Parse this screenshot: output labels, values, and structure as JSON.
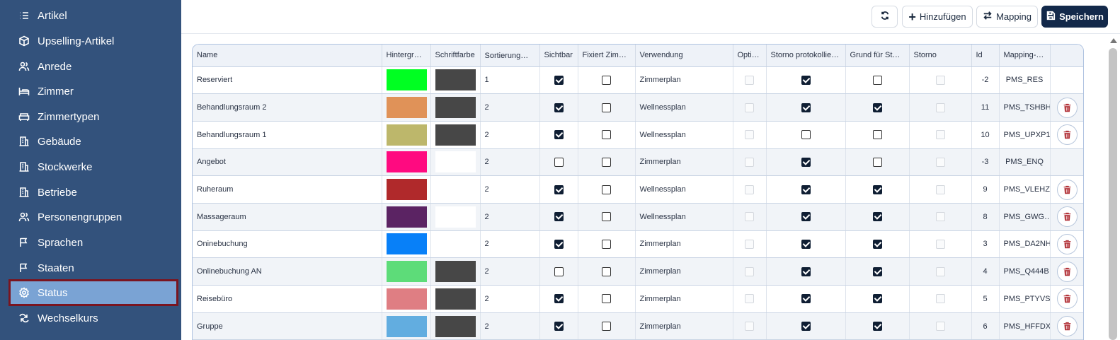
{
  "sidebar": {
    "items": [
      {
        "label": "Artikel",
        "icon": "list-icon"
      },
      {
        "label": "Upselling-Artikel",
        "icon": "package-icon"
      },
      {
        "label": "Anrede",
        "icon": "users-icon"
      },
      {
        "label": "Zimmer",
        "icon": "bed-icon"
      },
      {
        "label": "Zimmertypen",
        "icon": "sofa-icon"
      },
      {
        "label": "Gebäude",
        "icon": "building-icon"
      },
      {
        "label": "Stockwerke",
        "icon": "building-icon"
      },
      {
        "label": "Betriebe",
        "icon": "building-icon"
      },
      {
        "label": "Personengruppen",
        "icon": "users-icon"
      },
      {
        "label": "Sprachen",
        "icon": "flag-icon"
      },
      {
        "label": "Staaten",
        "icon": "flag-icon"
      },
      {
        "label": "Status",
        "icon": "gear-icon"
      },
      {
        "label": "Wechselkurs",
        "icon": "exchange-icon"
      }
    ],
    "active": "Status"
  },
  "toolbar": {
    "refresh_icon": "refresh-icon",
    "add_label": "Hinzufügen",
    "mapping_label": "Mapping",
    "save_label": "Speichern"
  },
  "table": {
    "columns": [
      "Name",
      "Hintergrun…",
      "Schriftfarbe",
      "Sortierung…",
      "Sichtbar",
      "Fixiert Zimmer",
      "Verwendung",
      "Opti…",
      "Storno protokollier…",
      "Grund für Stor…",
      "Storno",
      "Id",
      "Mapping-C…",
      ""
    ],
    "sort_indicator": "↑",
    "rows": [
      {
        "name": "Reserviert",
        "bg": "#00ff22",
        "fg": "#474747",
        "sort": "1",
        "visible": true,
        "fixed": false,
        "usage": "Zimmerplan",
        "storno_log": true,
        "reason": false,
        "id": "-2",
        "mapping": "PMS_RES",
        "deletable": false
      },
      {
        "name": "Behandlungsraum 2",
        "bg": "#e09258",
        "fg": "#474747",
        "sort": "2",
        "visible": true,
        "fixed": false,
        "usage": "Wellnessplan",
        "storno_log": true,
        "reason": true,
        "id": "11",
        "mapping": "PMS_TSHBH",
        "deletable": true
      },
      {
        "name": "Behandlungsraum 1",
        "bg": "#bdb76b",
        "fg": "#474747",
        "sort": "2",
        "visible": true,
        "fixed": false,
        "usage": "Wellnessplan",
        "storno_log": false,
        "reason": false,
        "id": "10",
        "mapping": "PMS_UPXP1",
        "deletable": true
      },
      {
        "name": "Angebot",
        "bg": "#ff0a80",
        "fg": "#ffffff",
        "sort": "2",
        "visible": false,
        "fixed": false,
        "usage": "Zimmerplan",
        "storno_log": true,
        "reason": false,
        "id": "-3",
        "mapping": "PMS_ENQ",
        "deletable": false
      },
      {
        "name": "Ruheraum",
        "bg": "#b0292b",
        "fg": "#ffffff",
        "sort": "2",
        "visible": true,
        "fixed": false,
        "usage": "Wellnessplan",
        "storno_log": true,
        "reason": true,
        "id": "9",
        "mapping": "PMS_VLEHZ",
        "deletable": true
      },
      {
        "name": "Massageraum",
        "bg": "#5b2363",
        "fg": "#ffffff",
        "sort": "2",
        "visible": true,
        "fixed": false,
        "usage": "Wellnessplan",
        "storno_log": true,
        "reason": true,
        "id": "8",
        "mapping": "PMS_GWG…",
        "deletable": true
      },
      {
        "name": "Oninebuchung",
        "bg": "#0880f8",
        "fg": "#ffffff",
        "sort": "2",
        "visible": true,
        "fixed": false,
        "usage": "Zimmerplan",
        "storno_log": true,
        "reason": true,
        "id": "3",
        "mapping": "PMS_DA2NH",
        "deletable": true
      },
      {
        "name": "Onlinebuchung AN",
        "bg": "#5ddc79",
        "fg": "#474747",
        "sort": "2",
        "visible": false,
        "fixed": false,
        "usage": "Zimmerplan",
        "storno_log": true,
        "reason": true,
        "id": "4",
        "mapping": "PMS_Q444B",
        "deletable": true
      },
      {
        "name": "Reisebüro",
        "bg": "#df7e83",
        "fg": "#474747",
        "sort": "2",
        "visible": true,
        "fixed": false,
        "usage": "Zimmerplan",
        "storno_log": true,
        "reason": true,
        "id": "5",
        "mapping": "PMS_PTYVS",
        "deletable": true
      },
      {
        "name": "Gruppe",
        "bg": "#62ade0",
        "fg": "#474747",
        "sort": "2",
        "visible": true,
        "fixed": false,
        "usage": "Zimmerplan",
        "storno_log": true,
        "reason": true,
        "id": "6",
        "mapping": "PMS_HFFDX",
        "deletable": true
      }
    ]
  }
}
